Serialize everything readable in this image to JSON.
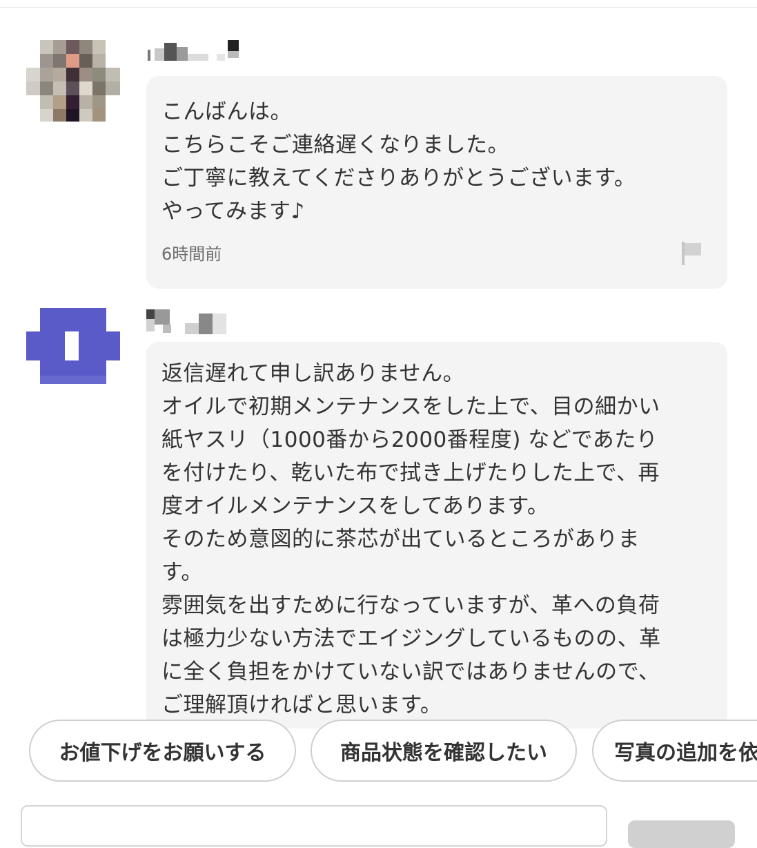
{
  "colors": {
    "bubble_bg": "#f4f4f4",
    "text": "#333333",
    "muted": "#6d6d6d",
    "chip_border": "#cfcfcf",
    "avatar2_color": "#5a5bc9"
  },
  "messages": [
    {
      "username": "",
      "avatar": "pixelated-photo-avatar",
      "lines": [
        "こんばんは。",
        "こちらこそご連絡遅くなりました。",
        "ご丁寧に教えてくださりありがとうございます。",
        "やってみます♪"
      ],
      "time": "6時間前",
      "report_icon": "flag-icon"
    },
    {
      "username": "",
      "avatar": "pixelated-default-avatar",
      "lines": [
        "返信遅れて申し訳ありません。",
        "オイルで初期メンテナンスをした上で、目の細かい",
        "紙ヤスリ（1000番から2000番程度) などであたり",
        "を付けたり、乾いた布で拭き上げたりした上で、再",
        "度オイルメンテナンスをしてあります。",
        "そのため意図的に茶芯が出ているところがありま",
        "す。",
        "雰囲気を出すために行なっていますが、革への負荷",
        "は極力少ない方法でエイジングしているものの、革",
        "に全く負担をかけていない訳ではありませんので、",
        "ご理解頂ければと思います。"
      ]
    }
  ],
  "quick_replies": [
    "お値下げをお願いする",
    "商品状態を確認したい",
    "写真の追加を依"
  ],
  "input": {
    "placeholder": ""
  }
}
